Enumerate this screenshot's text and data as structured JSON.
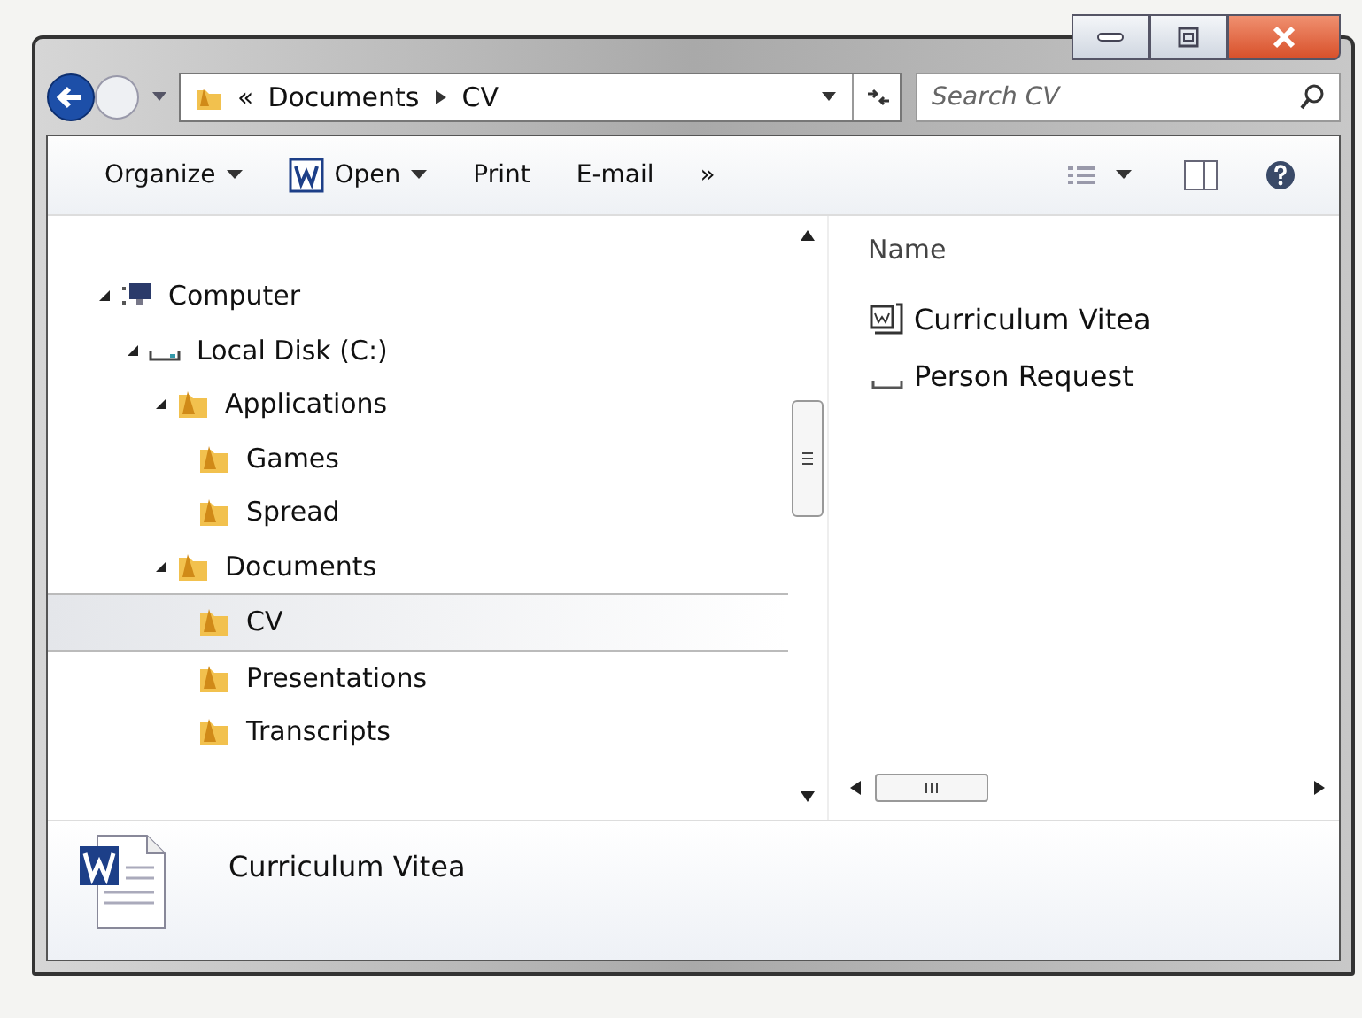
{
  "address": {
    "overflow": "«",
    "path": [
      "Documents",
      "CV"
    ]
  },
  "search": {
    "placeholder": "Search CV"
  },
  "toolbar": [
    {
      "label": "Organize",
      "kind": "menu"
    },
    {
      "label": "Open",
      "kind": "open"
    },
    {
      "label": "Print",
      "kind": "button"
    },
    {
      "label": "E-mail",
      "kind": "button"
    },
    {
      "label": "»",
      "kind": "more"
    }
  ],
  "navigation": [
    {
      "label": "Computer",
      "kind": "computer",
      "expanded": true,
      "selected": false,
      "children": [
        {
          "label": "Local Disk (C:)",
          "kind": "drive",
          "expanded": true,
          "selected": false,
          "children": [
            {
              "label": "Applications",
              "kind": "folder",
              "expanded": true,
              "selected": false,
              "children": [
                {
                  "label": "Games",
                  "kind": "folder",
                  "selected": false
                },
                {
                  "label": "Spread",
                  "kind": "folder",
                  "selected": false
                }
              ]
            },
            {
              "label": "Documents",
              "kind": "folder",
              "expanded": true,
              "selected": false,
              "children": [
                {
                  "label": "CV",
                  "kind": "folder",
                  "selected": true
                },
                {
                  "label": "Presentations",
                  "kind": "folder",
                  "selected": false
                },
                {
                  "label": "Transcripts",
                  "kind": "folder",
                  "selected": false
                }
              ]
            }
          ]
        }
      ]
    }
  ],
  "files": {
    "column": "Name",
    "items": [
      {
        "name": "Curriculum Vitea",
        "kind": "document"
      },
      {
        "name": "Person Request",
        "kind": "blank"
      }
    ]
  },
  "details": {
    "name": "Curriculum Vitea"
  }
}
